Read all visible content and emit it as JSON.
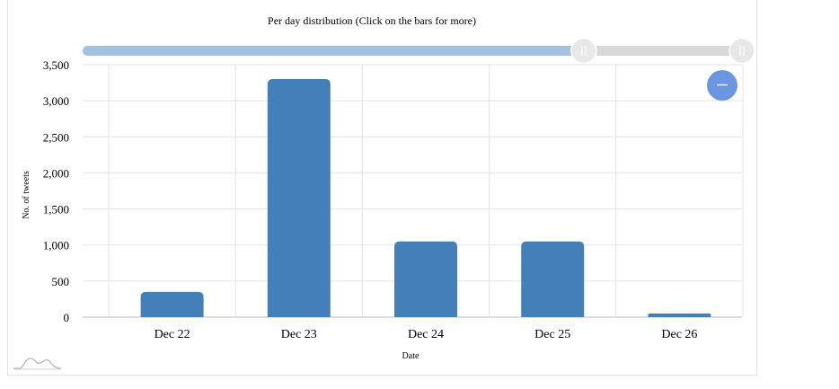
{
  "chart_data": {
    "type": "bar",
    "title": "Per day distribution (Click on the bars for more)",
    "xlabel": "Date",
    "ylabel": "No. of tweets",
    "categories": [
      "Dec 22",
      "Dec 23",
      "Dec 24",
      "Dec 25",
      "Dec 26"
    ],
    "values": [
      350,
      3300,
      1050,
      1050,
      50
    ],
    "ylim": [
      0,
      3500
    ],
    "yticks": [
      "0",
      "500",
      "1,000",
      "1,500",
      "2,000",
      "2,500",
      "3,000",
      "3,500"
    ],
    "ytick_values": [
      0,
      500,
      1000,
      1500,
      2000,
      2500,
      3000,
      3500
    ],
    "grid": true,
    "bar_color": "#4380b9",
    "scrollbar": {
      "start": 0.0,
      "end": 0.76,
      "fill_color": "#a4c1e0",
      "track_color": "#d9d9d9"
    }
  },
  "zoom_out": {
    "icon": "minus-icon",
    "color": "#6b97e0"
  }
}
